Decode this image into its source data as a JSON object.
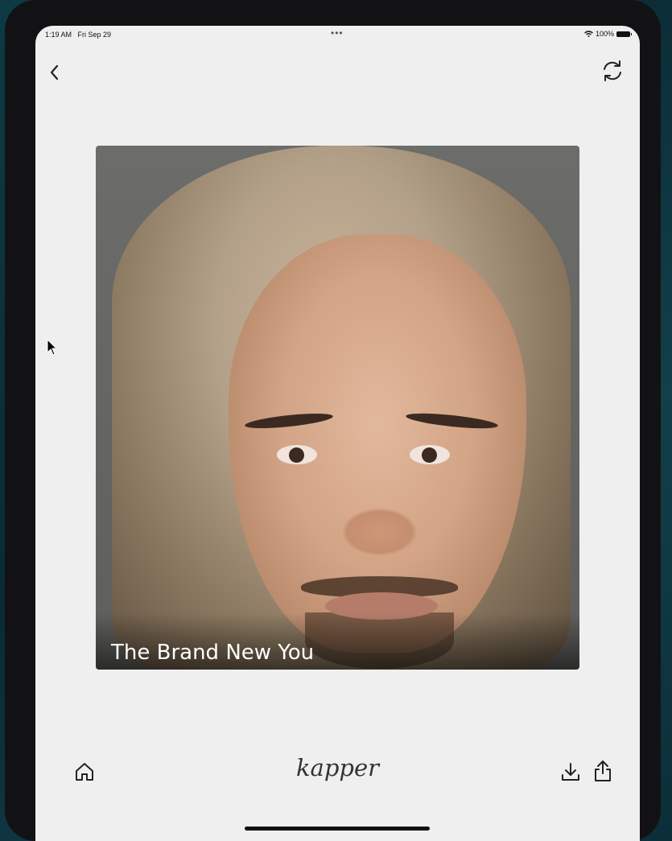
{
  "status_bar": {
    "time": "1:19 AM",
    "date": "Fri Sep 29",
    "dots": "•••",
    "battery": "100%"
  },
  "header": {
    "back_icon": "chevron-left-icon",
    "refresh_icon": "refresh-icon"
  },
  "photo": {
    "caption": "The Brand New You"
  },
  "footer": {
    "home_icon": "home-icon",
    "brand": "kapper",
    "download_icon": "download-icon",
    "share_icon": "share-icon"
  }
}
